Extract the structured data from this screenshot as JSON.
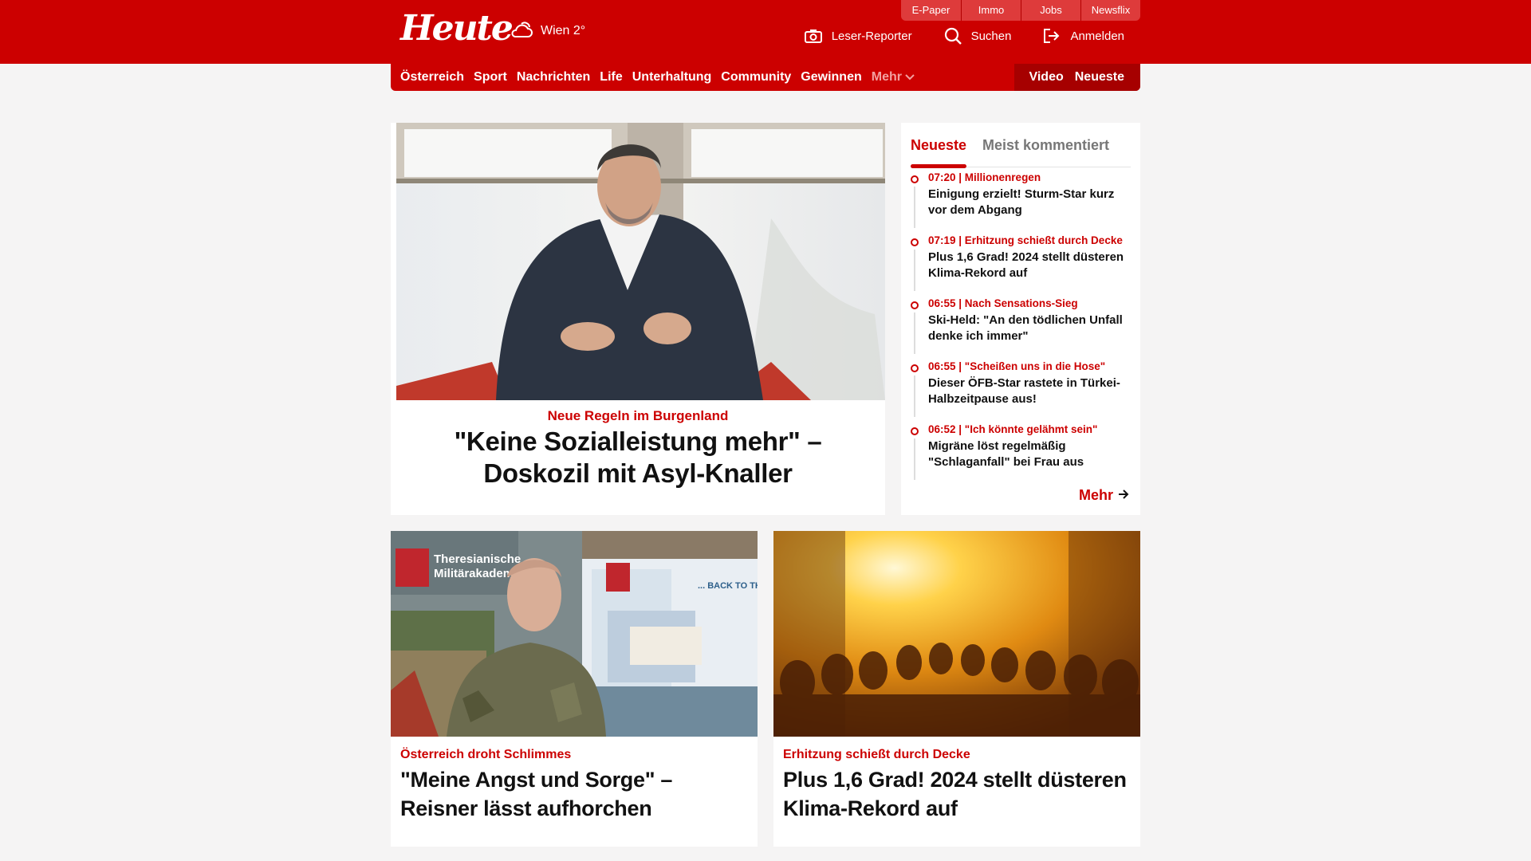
{
  "header": {
    "logo": "Heute",
    "weather": "Wien 2°",
    "ext_links": [
      "E-Paper",
      "Immo",
      "Jobs",
      "Newsflix"
    ],
    "leser_reporter": "Leser-Reporter",
    "search": "Suchen",
    "login": "Anmelden"
  },
  "nav": {
    "items": [
      "Österreich",
      "Sport",
      "Nachrichten",
      "Life",
      "Unterhaltung",
      "Community",
      "Gewinnen"
    ],
    "more": "Mehr",
    "video": "Video",
    "newest": "Neueste"
  },
  "hero": {
    "kicker": "Neue Regeln im Burgenland",
    "title": "\"Keine Sozialleistung mehr\" – Doskozil mit Asyl-Knaller"
  },
  "sidebar": {
    "tab_active": "Neueste",
    "tab_inactive": "Meist kommentiert",
    "items": [
      {
        "meta": "07:20 | Millionenregen",
        "title": "Einigung erzielt! Sturm-Star kurz vor dem Abgang"
      },
      {
        "meta": "07:19 | Erhitzung schießt durch Decke",
        "title": "Plus 1,6 Grad! 2024 stellt düsteren Klima-Rekord auf"
      },
      {
        "meta": "06:55 | Nach Sensations-Sieg",
        "title": "Ski-Held: \"An den tödlichen Unfall denke ich immer\""
      },
      {
        "meta": "06:55 | \"Scheißen uns in die Hose\"",
        "title": "Dieser ÖFB-Star rastete in Türkei-Halbzeitpause aus!"
      },
      {
        "meta": "06:52 | \"Ich könnte gelähmt sein\"",
        "title": "Migräne löst regelmäßig \"Schlaganfall\" bei Frau aus"
      }
    ],
    "more": "Mehr"
  },
  "cards": [
    {
      "kicker": "Österreich droht Schlimmes",
      "title": "\"Meine Angst und Sorge\" – Reisner lässt aufhorchen",
      "image_text_1": "Theresianische",
      "image_text_2": "Militärakademie",
      "image_text_3": "... BACK TO TH"
    },
    {
      "kicker": "Erhitzung schießt durch Decke",
      "title": "Plus 1,6 Grad! 2024 stellt düsteren Klima-Rekord auf"
    }
  ],
  "colors": {
    "brand": "#cc0000",
    "brand_dark": "#a60000",
    "background": "#f5f4f4"
  }
}
